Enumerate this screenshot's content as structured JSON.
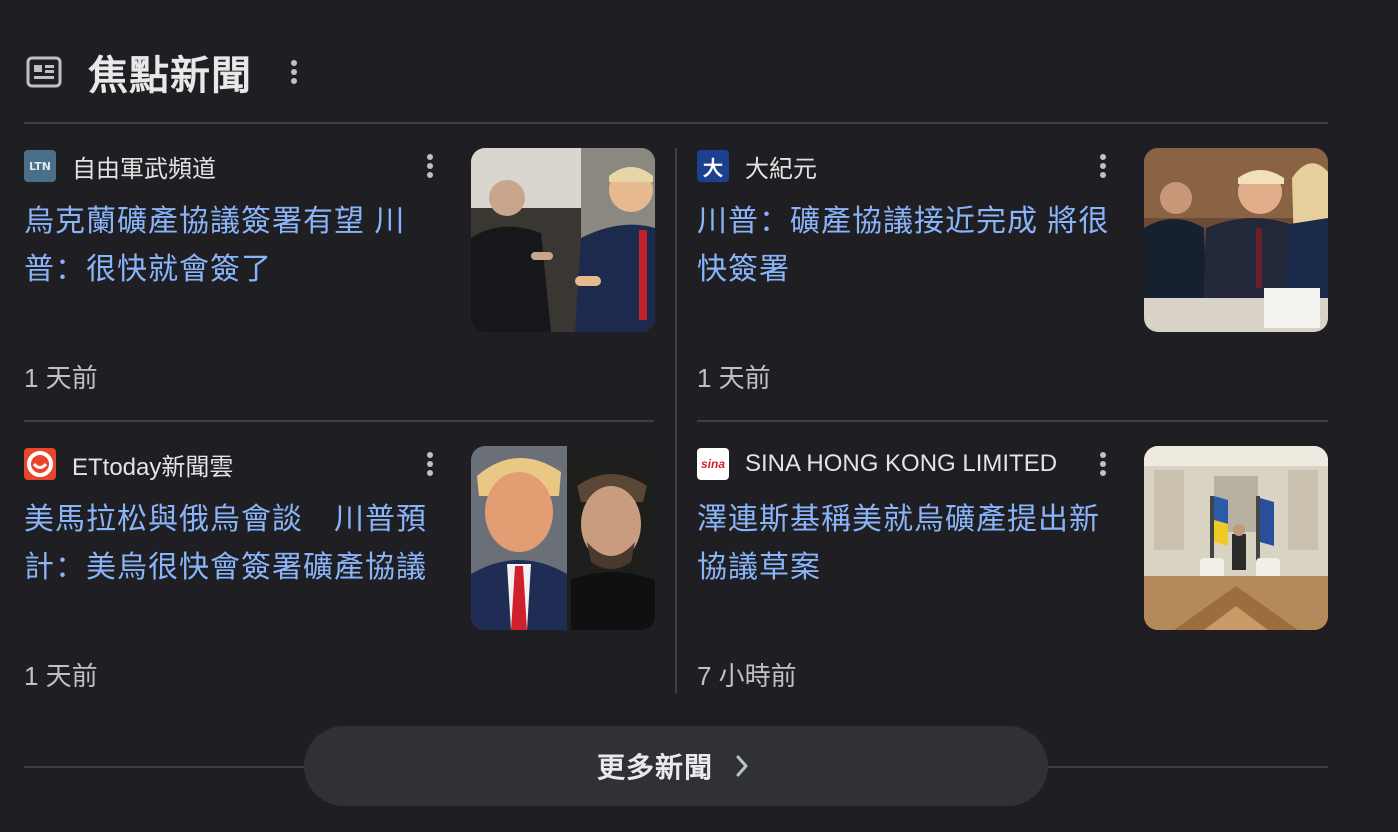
{
  "header": {
    "title": "焦點新聞",
    "icon": "newspaper-icon",
    "more_icon": "more-vert-icon"
  },
  "articles": [
    {
      "source": "自由軍武頻道",
      "source_logo_text": "LTN",
      "headline": "烏克蘭礦產協議簽署有望 川普：很快就會簽了",
      "time": "1 天前",
      "image": "zelensky-trump-meeting-photo"
    },
    {
      "source": "大紀元",
      "source_logo_text": "大",
      "headline": "川普：礦產協議接近完成 將很快簽署",
      "time": "1 天前",
      "image": "trump-at-table-photo"
    },
    {
      "source": "ETtoday新聞雲",
      "source_logo_text": "",
      "headline": "美馬拉松與俄烏會談　川普預計：美烏很快會簽署礦產協議",
      "time": "1 天前",
      "image": "trump-zelensky-split-photo"
    },
    {
      "source": "SINA HONG KONG LIMITED",
      "source_logo_text": "sina",
      "headline": "澤連斯基稱美就烏礦產提出新協議草案",
      "time": "7 小時前",
      "image": "ornate-hall-flags-photo"
    }
  ],
  "more_news": {
    "label": "更多新聞",
    "icon": "chevron-right-icon"
  },
  "colors": {
    "background": "#1f1f23",
    "headline": "#8ab4f8",
    "divider": "#3c4043",
    "button_bg": "#303134"
  }
}
